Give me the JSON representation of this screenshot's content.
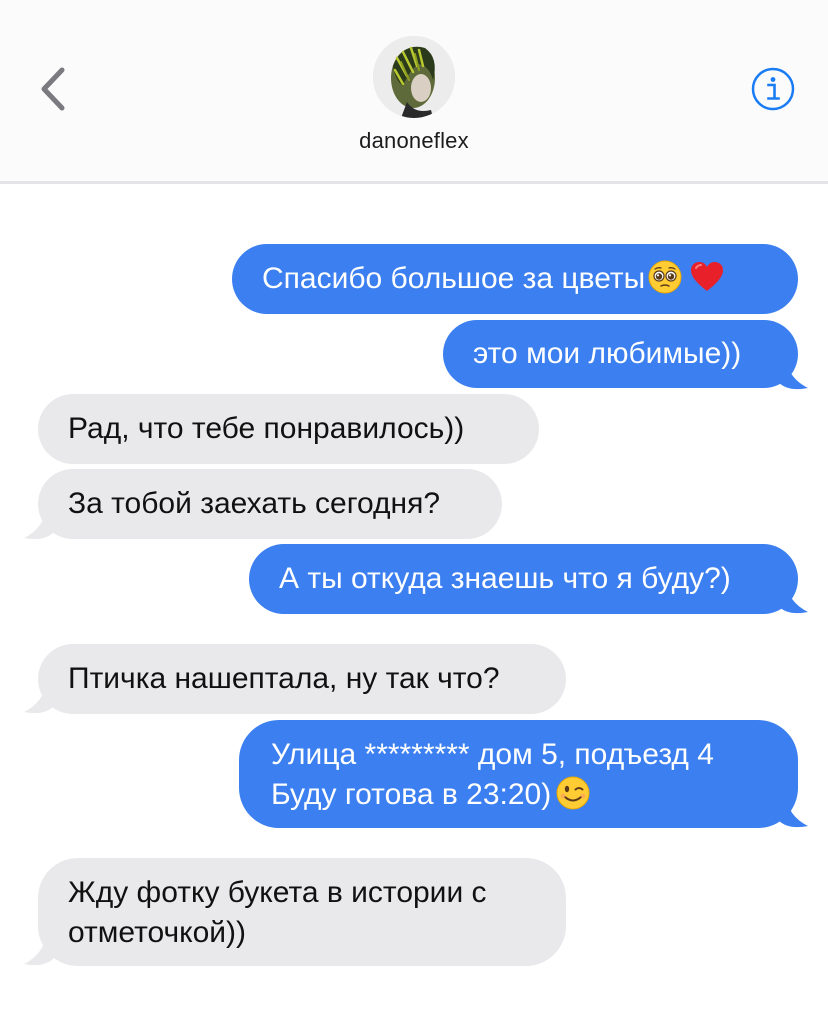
{
  "header": {
    "contact_name": "danoneflex"
  },
  "messages": [
    {
      "direction": "outgoing",
      "text": "Спасибо большое за цветы"
    },
    {
      "direction": "outgoing",
      "text": "это мои любимые))"
    },
    {
      "direction": "incoming",
      "text": "Рад, что тебе понравилось))"
    },
    {
      "direction": "incoming",
      "text": "За тобой заехать сегодня?"
    },
    {
      "direction": "outgoing",
      "text": "А ты откуда знаешь что я буду?)"
    },
    {
      "direction": "incoming",
      "text": "Птичка нашептала, ну так что?"
    },
    {
      "direction": "outgoing",
      "lines": [
        "Улица ********* дом 5, подъезд 4",
        "Буду готова в 23:20)"
      ]
    },
    {
      "direction": "incoming",
      "lines": [
        "Жду фотку букета в истории с",
        "отметочкой))"
      ]
    }
  ],
  "icons": {
    "back": "chevron-left-icon",
    "info": "info-icon",
    "emoji_1": "pleading-face-emoji",
    "emoji_2": "red-heart-emoji",
    "emoji_3": "winking-face-emoji"
  },
  "colors": {
    "outgoing_bubble": "#3b7ff0",
    "incoming_bubble": "#e9e9eb",
    "accent": "#1a7cf5"
  }
}
